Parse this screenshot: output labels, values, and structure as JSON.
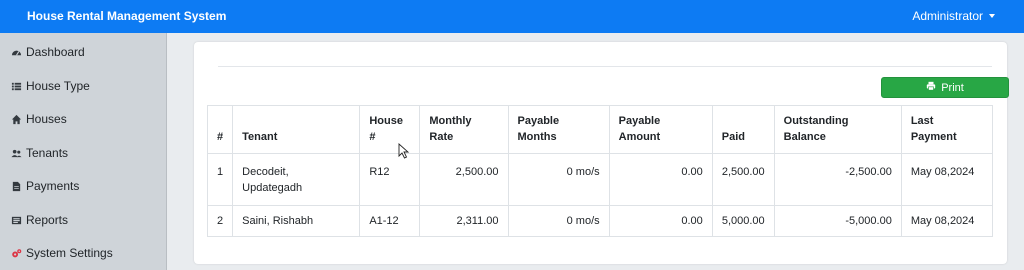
{
  "app": {
    "title": "House Rental Management System",
    "user": "Administrator"
  },
  "sidebar": {
    "items": [
      {
        "label": "Dashboard",
        "icon": "dashboard-icon"
      },
      {
        "label": "House Type",
        "icon": "list-icon"
      },
      {
        "label": "Houses",
        "icon": "home-icon"
      },
      {
        "label": "Tenants",
        "icon": "users-icon"
      },
      {
        "label": "Payments",
        "icon": "file-icon"
      },
      {
        "label": "Reports",
        "icon": "report-icon"
      },
      {
        "label": "System Settings",
        "icon": "cogs-icon"
      }
    ]
  },
  "toolbar": {
    "print_label": "Print"
  },
  "table": {
    "headers": [
      [
        "#"
      ],
      [
        "Tenant"
      ],
      [
        "House",
        "#"
      ],
      [
        "Monthly",
        "Rate"
      ],
      [
        "Payable",
        "Months"
      ],
      [
        "Payable",
        "Amount"
      ],
      [
        "Paid"
      ],
      [
        "Outstanding",
        "Balance"
      ],
      [
        "Last",
        "Payment"
      ]
    ],
    "rows": [
      {
        "idx": "1",
        "tenant": [
          "Decodeit,",
          "Updategadh"
        ],
        "house": "R12",
        "rate": "2,500.00",
        "months": "0 mo/s",
        "amount": "0.00",
        "paid": "2,500.00",
        "balance": "-2,500.00",
        "last": "May 08,2024"
      },
      {
        "idx": "2",
        "tenant": [
          "Saini, Rishabh"
        ],
        "house": "A1-12",
        "rate": "2,311.00",
        "months": "0 mo/s",
        "amount": "0.00",
        "paid": "5,000.00",
        "balance": "-5,000.00",
        "last": "May 08,2024"
      }
    ]
  },
  "colors": {
    "header_bg": "#0d7bf3",
    "sidebar_bg": "#cfd4d9",
    "print_button": "#28a745",
    "settings_icon": "#dc3545"
  }
}
